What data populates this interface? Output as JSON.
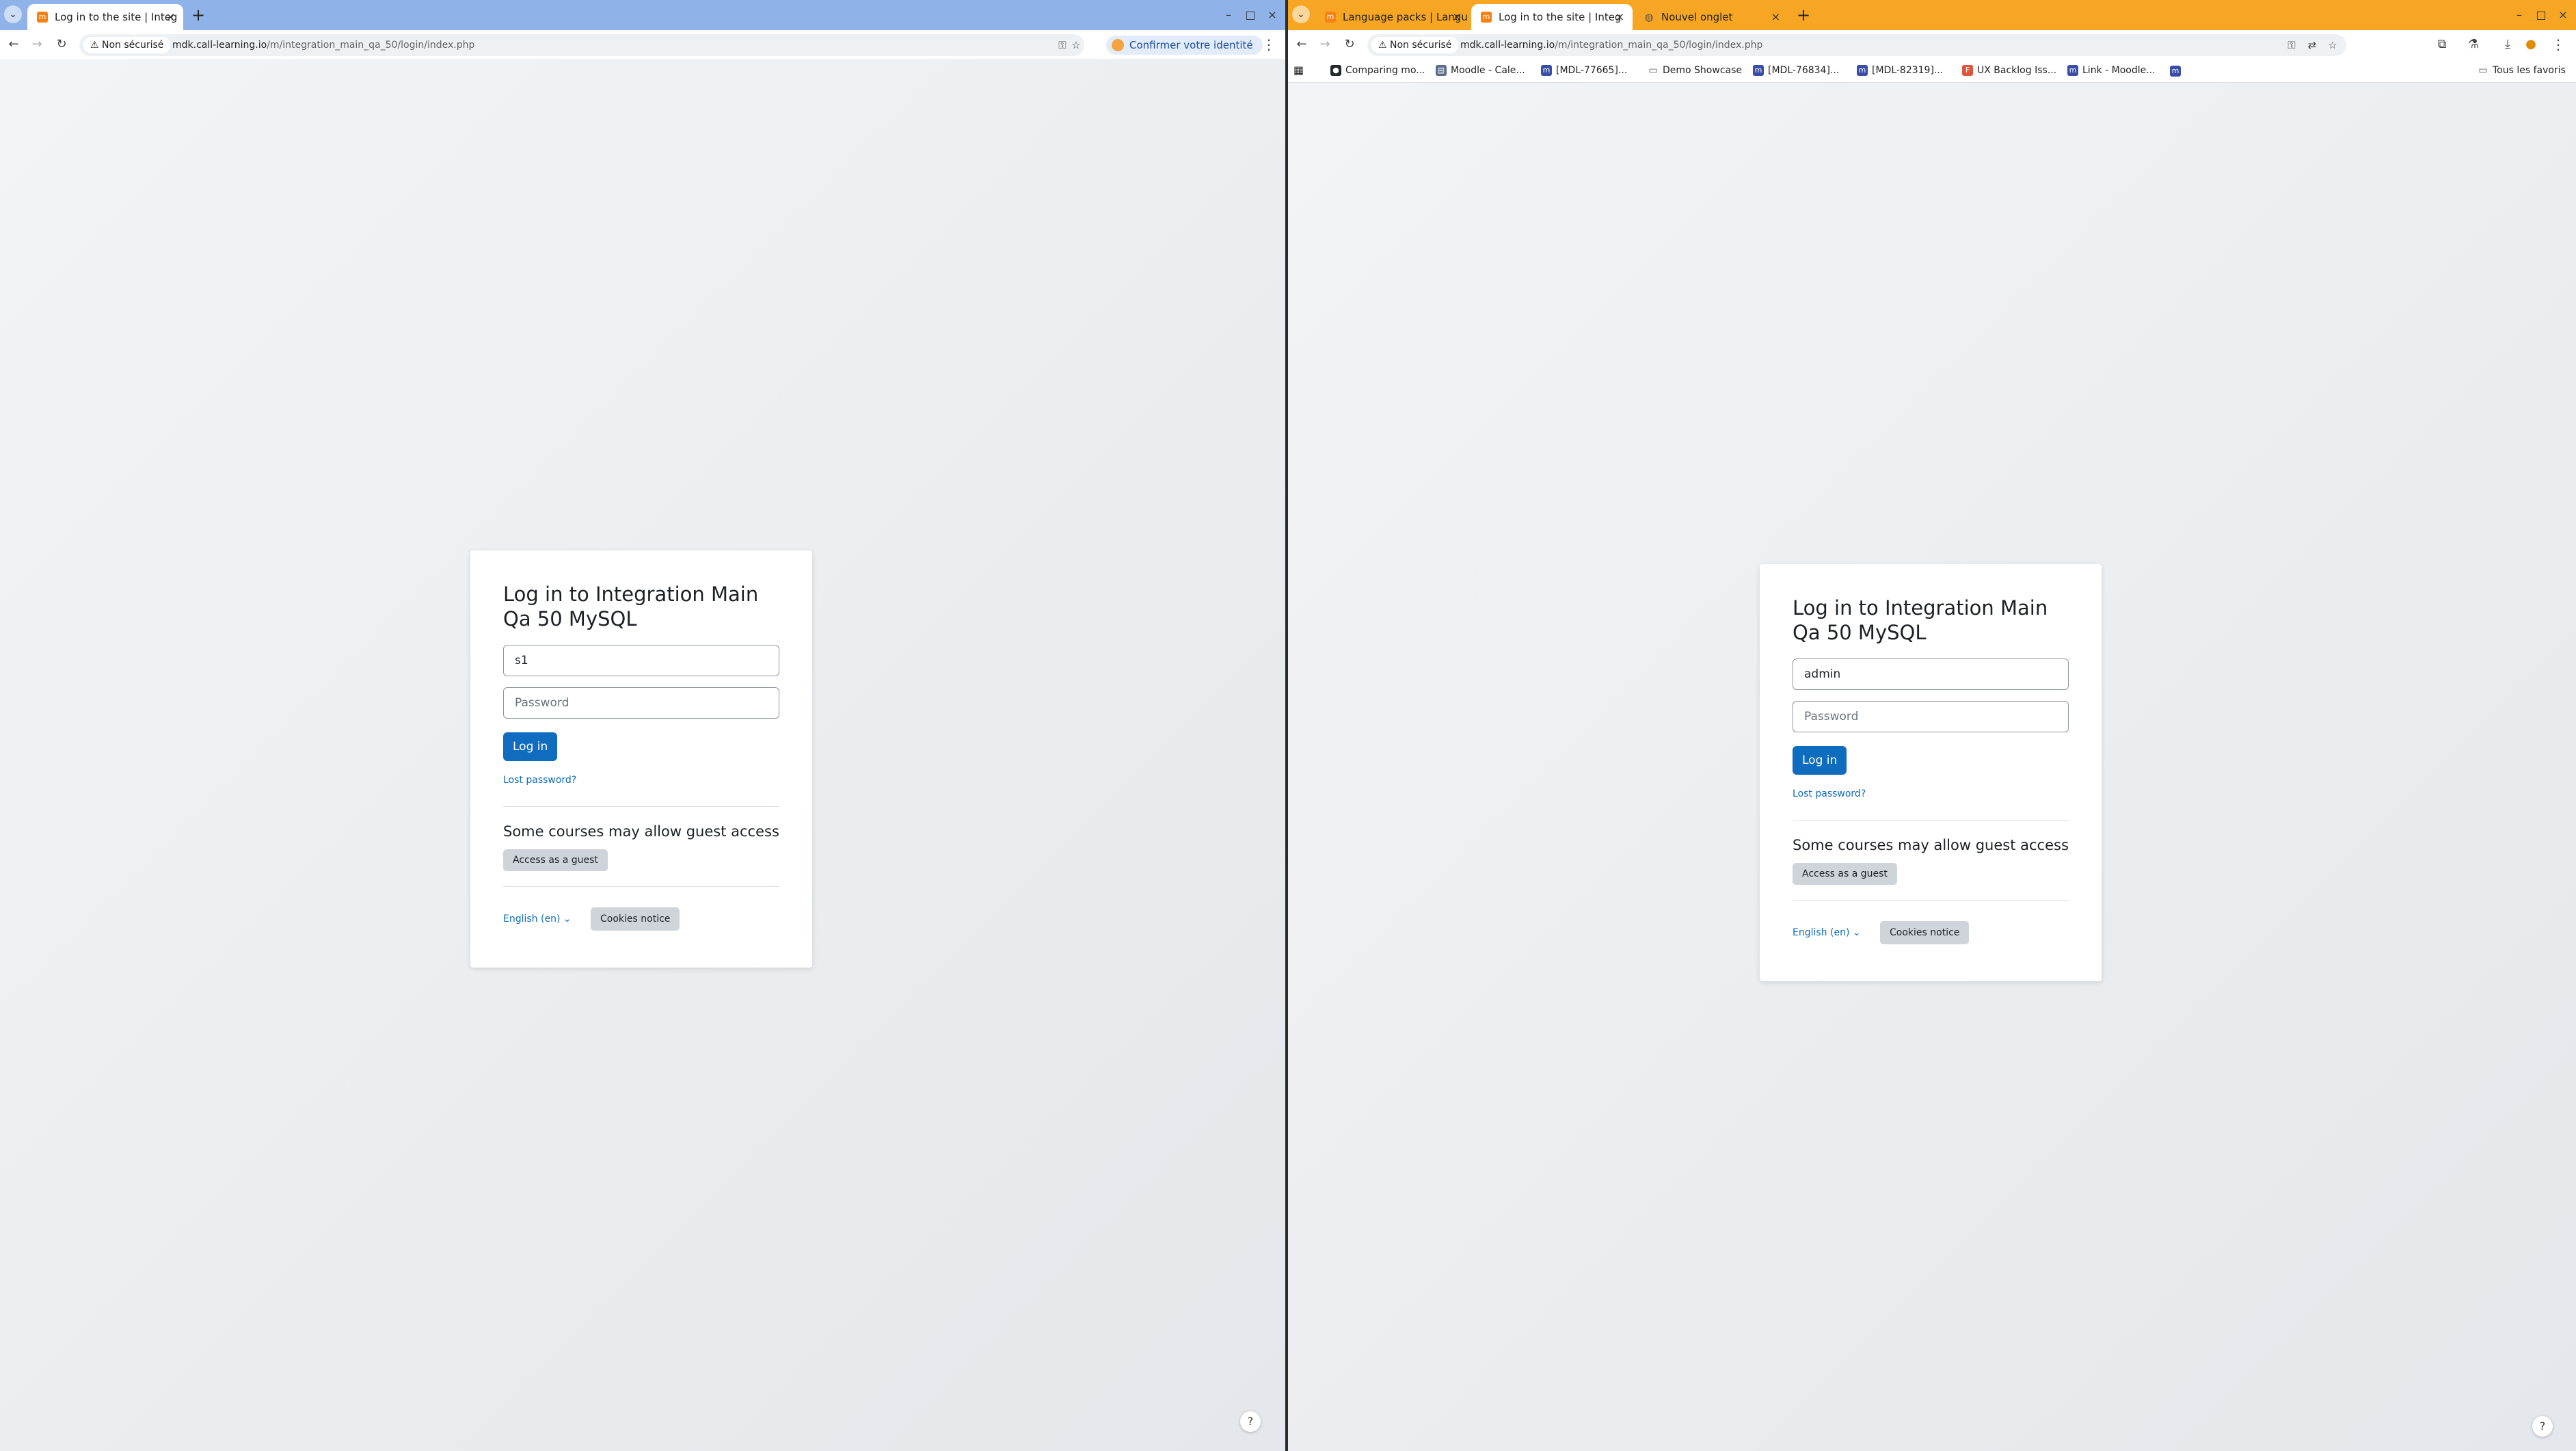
{
  "left": {
    "tab_label": "Log in to the site | Integ",
    "omnibox": {
      "security": "Non sécurisé",
      "host": "mdk.call-learning.io",
      "path": "/m/integration_main_qa_50/login/index.php"
    },
    "identity_label": "Confirmer votre identité",
    "login": {
      "title": "Log in to Integration Main Qa 50 MySQL",
      "username": "s1",
      "password_placeholder": "Password",
      "login_button": "Log in",
      "lost_password": "Lost password?",
      "guest_heading": "Some courses may allow guest access",
      "guest_button": "Access as a guest",
      "language": "English (en)",
      "cookies_button": "Cookies notice"
    },
    "help_label": "?"
  },
  "right": {
    "tabs": [
      {
        "label": "Language packs | Langu",
        "icon": "moodle-favicon",
        "active": false
      },
      {
        "label": "Log in to the site | Integ",
        "icon": "moodle-favicon",
        "active": true
      },
      {
        "label": "Nouvel onglet",
        "icon": "globe-icon",
        "active": false
      }
    ],
    "omnibox": {
      "security": "Non sécurisé",
      "host": "mdk.call-learning.io",
      "path": "/m/integration_main_qa_50/login/index.php"
    },
    "bookmarks": [
      {
        "label": "Comparing mo..."
      },
      {
        "label": "Moodle - Cale..."
      },
      {
        "label": "[MDL-77665]..."
      },
      {
        "label": "Demo Showcase"
      },
      {
        "label": "[MDL-76834]..."
      },
      {
        "label": "[MDL-82319]..."
      },
      {
        "label": "UX Backlog Iss..."
      },
      {
        "label": "Link - Moodle..."
      }
    ],
    "all_bookmarks": "Tous les favoris",
    "login": {
      "title": "Log in to Integration Main Qa 50 MySQL",
      "username": "admin",
      "password_placeholder": "Password",
      "login_button": "Log in",
      "lost_password": "Lost password?",
      "guest_heading": "Some courses may allow guest access",
      "guest_button": "Access as a guest",
      "language": "English (en)",
      "cookies_button": "Cookies notice"
    },
    "help_label": "?"
  },
  "colors": {
    "left_chrome": "#8fb3e8",
    "right_chrome": "#f6a623",
    "moodle_primary": "#0f6cbf"
  }
}
